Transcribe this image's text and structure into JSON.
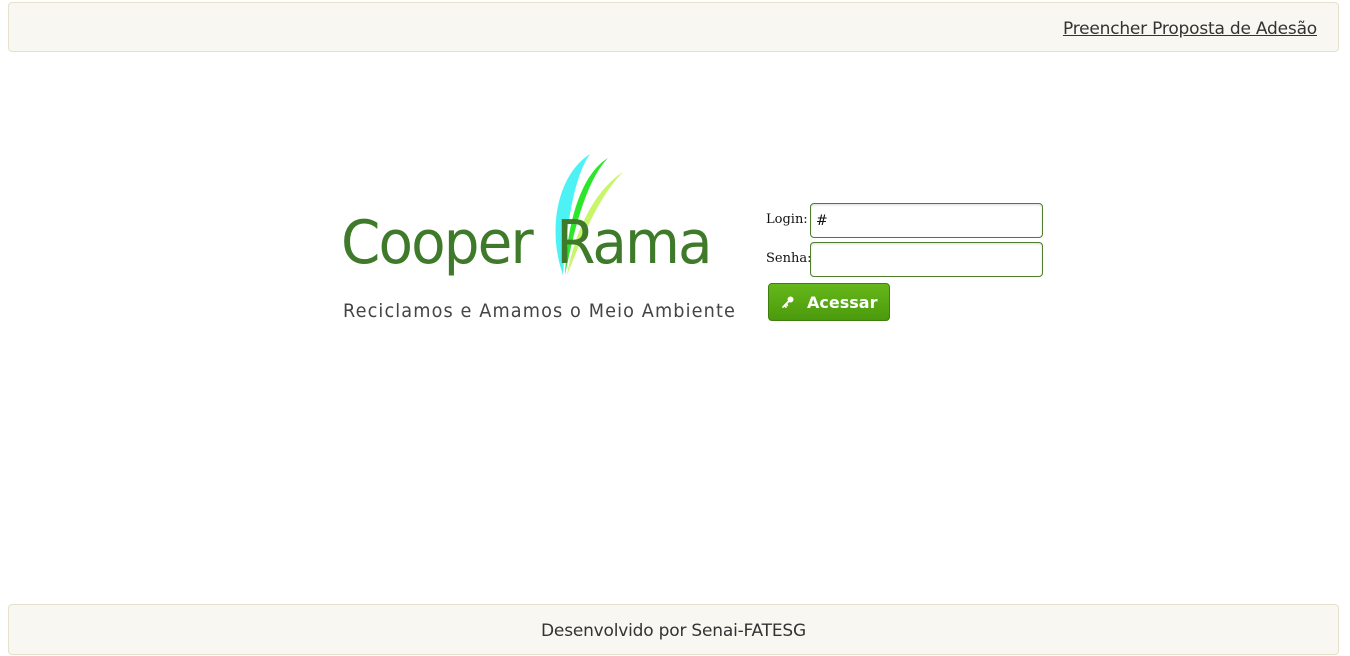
{
  "header": {
    "proposal_link": "Preencher Proposta de Adesão"
  },
  "logo": {
    "word1": "Cooper",
    "word2": "Rama",
    "tagline": "Reciclamos e Amamos o Meio Ambiente",
    "colors": {
      "text": "#3f7a2a",
      "leaf_cyan": "#4cf2f4",
      "leaf_green": "#2be62b",
      "leaf_lime": "#c8f56a"
    }
  },
  "login": {
    "login_label": "Login:",
    "login_value": "#",
    "password_label": "Senha:",
    "password_value": "",
    "submit_label": "Acessar",
    "submit_icon": "key-icon",
    "accent_color": "#55a514"
  },
  "footer": {
    "text": "Desenvolvido por Senai-FATESG"
  }
}
